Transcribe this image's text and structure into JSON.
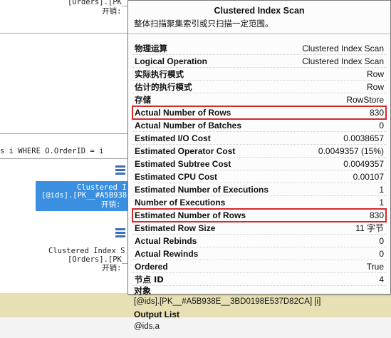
{
  "plan": {
    "top_node_line1": "[Orders].[PK__",
    "top_node_cost": "开销:",
    "query_text": "s i WHERE O.OrderID = i",
    "selected_node_line1": "Clustered I",
    "selected_node_line2": "[@ids].[PK__#A5B938",
    "selected_node_cost": "开销:",
    "lower_node_line1": "Clustered Index S",
    "lower_node_line2": "[Orders].[PK__",
    "lower_node_cost": "开销:"
  },
  "tooltip": {
    "title": "Clustered Index Scan",
    "description": "整体扫描聚集索引或只扫描一定范围。",
    "rows": [
      {
        "label": "物理运算",
        "value": "Clustered Index Scan",
        "cjk": true
      },
      {
        "label": "Logical Operation",
        "value": "Clustered Index Scan"
      },
      {
        "label": "实际执行模式",
        "value": "Row",
        "cjk": true
      },
      {
        "label": "估计的执行模式",
        "value": "Row",
        "cjk": true
      },
      {
        "label": "存储",
        "value": "RowStore",
        "cjk": true
      },
      {
        "label": "Actual Number of Rows",
        "value": "830",
        "highlight": true
      },
      {
        "label": "Actual Number of Batches",
        "value": "0"
      },
      {
        "label": "Estimated I/O Cost",
        "value": "0.0038657"
      },
      {
        "label": "Estimated Operator Cost",
        "value": "0.0049357 (15%)"
      },
      {
        "label": "Estimated Subtree Cost",
        "value": "0.0049357"
      },
      {
        "label": "Estimated CPU Cost",
        "value": "0.00107"
      },
      {
        "label": "Estimated Number of Executions",
        "value": "1"
      },
      {
        "label": "Number of Executions",
        "value": "1"
      },
      {
        "label": "Estimated Number of Rows",
        "value": "830",
        "highlight": true
      },
      {
        "label": "Estimated Row Size",
        "value": "11 字节"
      },
      {
        "label": "Actual Rebinds",
        "value": "0"
      },
      {
        "label": "Actual Rewinds",
        "value": "0"
      },
      {
        "label": "Ordered",
        "value": "True"
      },
      {
        "label": "节点 ID",
        "value": "4",
        "cjk": true
      }
    ],
    "object_heading": "对象",
    "object_value": "[@ids].[PK__#A5B938E__3BD0198E537D82CA] [i]",
    "output_heading": "Output List",
    "output_value": "@ids.a"
  }
}
